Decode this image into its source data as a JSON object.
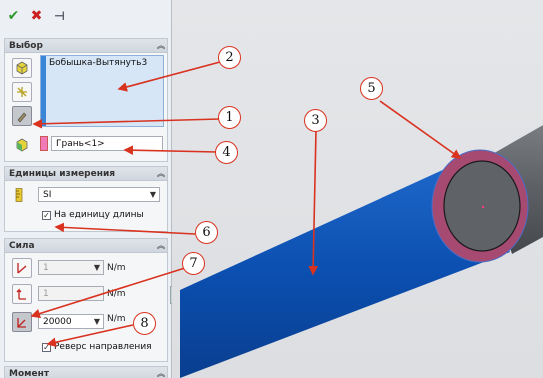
{
  "toolbar": {
    "ok_icon": "✔",
    "cancel_icon": "✖",
    "pin_icon": "⊣"
  },
  "selection": {
    "header": "Выбор",
    "item": "Бобышка-Вытянуть3",
    "face": "Грань<1>"
  },
  "units": {
    "header": "Единицы измерения",
    "system": "SI",
    "per_length_label": "На единицу длины",
    "per_length_checked": "✓"
  },
  "force": {
    "header": "Сила",
    "field1": "1",
    "field2": "1",
    "field3": "20000",
    "unit1": "N/m",
    "unit2": "N/m",
    "unit3": "N/m",
    "reverse_label": "Реверс направления",
    "reverse_checked": "✓"
  },
  "moment": {
    "header": "Момент"
  },
  "markers": [
    "1",
    "2",
    "3",
    "4",
    "5",
    "6",
    "7",
    "8"
  ],
  "colors": {
    "accent": "#3a86d6",
    "marker_arrow": "#d9321f",
    "pipe_blue": "#0f55b5",
    "pipe_end_pink": "#b04d7a"
  }
}
